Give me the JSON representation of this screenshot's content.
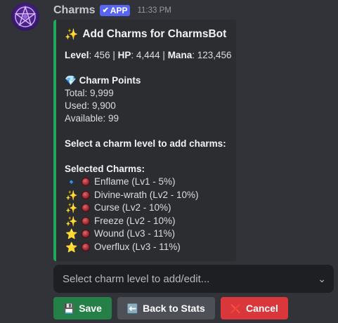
{
  "author": {
    "name": "Charms",
    "badge": "APP",
    "time": "11:33 PM"
  },
  "embed": {
    "accent": "#23a55a",
    "title_emoji": "✨",
    "title": "Add Charms for CharmsBot",
    "level_label": "Level",
    "level": "456",
    "hp_label": "HP",
    "hp": "4,444",
    "mana_label": "Mana",
    "mana": "123,456",
    "points_emoji": "💎",
    "points_label": "Charm Points",
    "total": "Total: 9,999",
    "used": "Used: 9,900",
    "available": "Available: 99",
    "prompt": "Select a charm level to add charms:",
    "selected_label": "Selected Charms:",
    "charms": [
      {
        "emoji": "🔹",
        "label": "Enflame (Lv1 - 5%)"
      },
      {
        "emoji": "✨",
        "label": "Divine-wrath (Lv2 - 10%)"
      },
      {
        "emoji": "✨",
        "label": "Curse (Lv2 - 10%)"
      },
      {
        "emoji": "✨",
        "label": "Freeze (Lv2 - 10%)"
      },
      {
        "emoji": "⭐",
        "label": "Wound (Lv3 - 11%)"
      },
      {
        "emoji": "⭐",
        "label": "Overflux (Lv3 - 11%)"
      }
    ]
  },
  "select": {
    "placeholder": "Select charm level to add/edit..."
  },
  "buttons": {
    "save": {
      "icon": "💾",
      "label": "Save",
      "color": "#248046"
    },
    "back": {
      "icon": "⬅️",
      "label": "Back to Stats",
      "color": "#4e5058"
    },
    "cancel": {
      "icon": "❌",
      "label": "Cancel",
      "color": "#da373c"
    }
  }
}
